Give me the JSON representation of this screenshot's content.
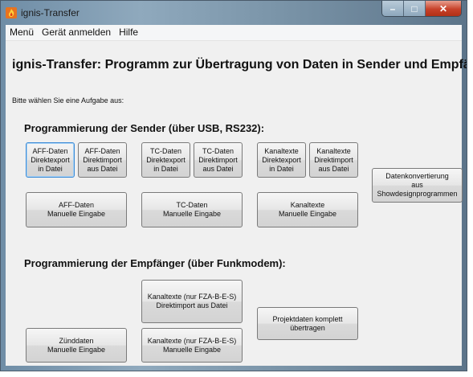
{
  "window": {
    "title": "ignis-Transfer",
    "minimize_glyph": "–",
    "maximize_glyph": "□",
    "close_glyph": "✕"
  },
  "menu": [
    {
      "label": "Menü"
    },
    {
      "label": "Gerät anmelden"
    },
    {
      "label": "Hilfe"
    }
  ],
  "heading": "ignis-Transfer: Programm zur Übertragung von Daten in Sender und Empfänger.",
  "subtitle": "Bitte wählen Sie eine Aufgabe aus:",
  "sender_section": {
    "title": "Programmierung der Sender (über USB, RS232):",
    "buttons": {
      "aff_export": "AFF-Daten\nDirektexport\nin Datei",
      "aff_import": "AFF-Daten\nDirektimport\naus Datei",
      "tc_export": "TC-Daten\nDirektexport\nin Datei",
      "tc_import": "TC-Daten\nDirektimport\naus Datei",
      "kanal_export": "Kanaltexte\nDirektexport\nin Datei",
      "kanal_import": "Kanaltexte\nDirektimport\naus Datei",
      "datenkonvertierung": "Datenkonvertierung\naus\nShowdesignprogrammen",
      "aff_manual": "AFF-Daten\nManuelle Eingabe",
      "tc_manual": "TC-Daten\nManuelle Eingabe",
      "kanal_manual": "Kanaltexte\nManuelle Eingabe"
    }
  },
  "receiver_section": {
    "title": "Programmierung der Empfänger (über Funkmodem):",
    "buttons": {
      "kanal_fza_import": "Kanaltexte (nur FZA-B-E-S)\nDirektimport aus Datei",
      "projektdaten": "Projektdaten komplett\nübertragen",
      "zuenddaten_manual": "Zünddaten\nManuelle Eingabe",
      "kanal_fza_manual": "Kanaltexte (nur FZA-B-E-S)\nManuelle Eingabe"
    }
  },
  "colors": {
    "frame": "#7a94a8",
    "client_bg": "#f0f0f0",
    "focus_border": "#3c8bd6",
    "close_button": "#c7412a"
  }
}
